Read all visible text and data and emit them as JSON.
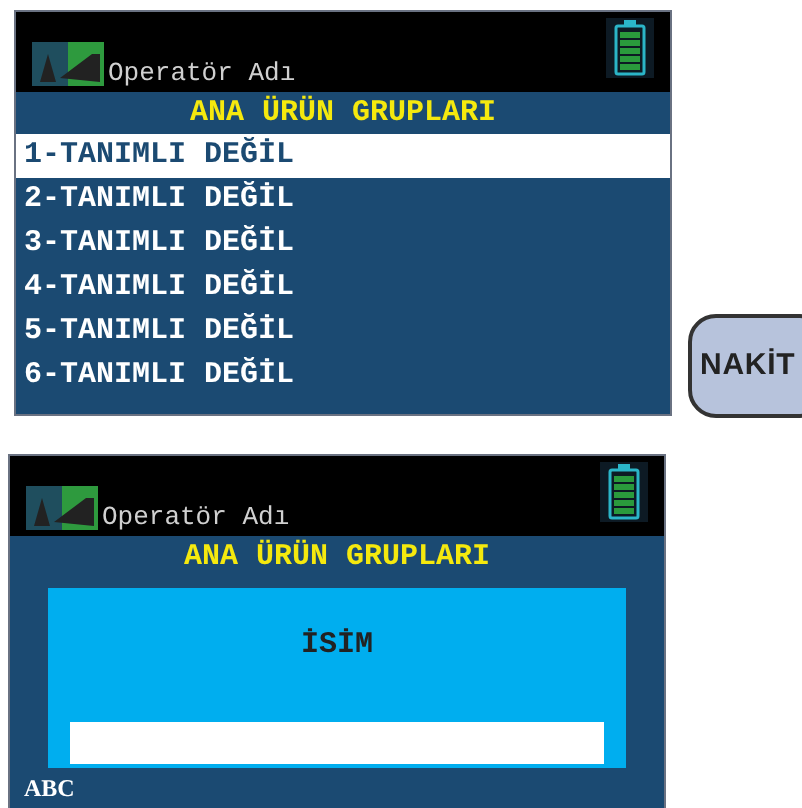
{
  "screens": [
    {
      "operator": "Operatör Adı",
      "title": "ANA ÜRÜN GRUPLARI",
      "kind": "list",
      "items": [
        {
          "label": "1-TANIMLI DEĞİL",
          "selected": true
        },
        {
          "label": "2-TANIMLI DEĞİL",
          "selected": false
        },
        {
          "label": "3-TANIMLI DEĞİL",
          "selected": false
        },
        {
          "label": "4-TANIMLI DEĞİL",
          "selected": false
        },
        {
          "label": "5-TANIMLI DEĞİL",
          "selected": false
        },
        {
          "label": "6-TANIMLI DEĞİL",
          "selected": false
        }
      ]
    },
    {
      "operator": "Operatör Adı",
      "title": "ANA ÜRÜN GRUPLARI",
      "kind": "input",
      "dialog_label": "İSİM",
      "input_mode": "ABC"
    }
  ],
  "side_button": "NAKİT"
}
